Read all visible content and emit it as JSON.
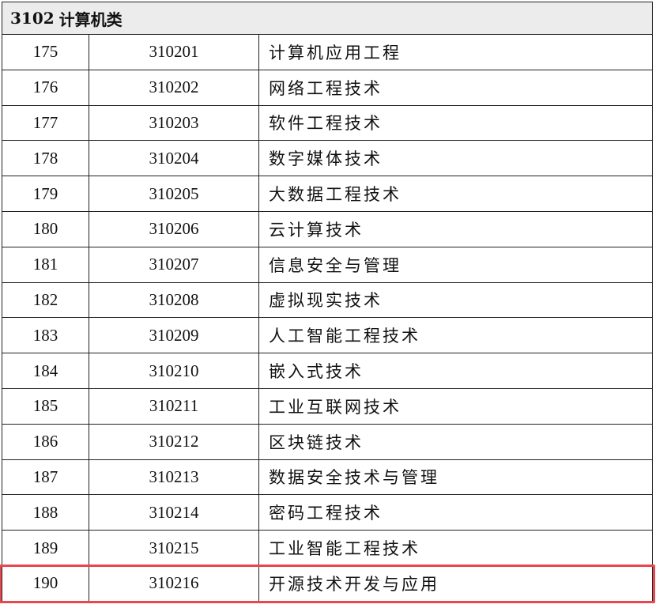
{
  "category": {
    "code": "3102",
    "name": "计算机类"
  },
  "rows": [
    {
      "seq": "175",
      "code": "310201",
      "name": "计算机应用工程"
    },
    {
      "seq": "176",
      "code": "310202",
      "name": "网络工程技术"
    },
    {
      "seq": "177",
      "code": "310203",
      "name": "软件工程技术"
    },
    {
      "seq": "178",
      "code": "310204",
      "name": "数字媒体技术"
    },
    {
      "seq": "179",
      "code": "310205",
      "name": "大数据工程技术"
    },
    {
      "seq": "180",
      "code": "310206",
      "name": "云计算技术"
    },
    {
      "seq": "181",
      "code": "310207",
      "name": "信息安全与管理"
    },
    {
      "seq": "182",
      "code": "310208",
      "name": "虚拟现实技术"
    },
    {
      "seq": "183",
      "code": "310209",
      "name": "人工智能工程技术"
    },
    {
      "seq": "184",
      "code": "310210",
      "name": "嵌入式技术"
    },
    {
      "seq": "185",
      "code": "310211",
      "name": "工业互联网技术"
    },
    {
      "seq": "186",
      "code": "310212",
      "name": "区块链技术"
    },
    {
      "seq": "187",
      "code": "310213",
      "name": "数据安全技术与管理"
    },
    {
      "seq": "188",
      "code": "310214",
      "name": "密码工程技术"
    },
    {
      "seq": "189",
      "code": "310215",
      "name": "工业智能工程技术"
    },
    {
      "seq": "190",
      "code": "310216",
      "name": "开源技术开发与应用"
    }
  ],
  "highlight_color": "#e8474f"
}
